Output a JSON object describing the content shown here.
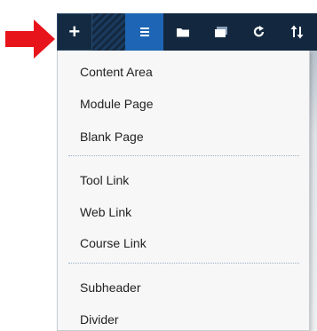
{
  "toolbar": {
    "add_label": "+",
    "buttons": [
      {
        "icon": "list-icon"
      },
      {
        "icon": "folder-icon"
      },
      {
        "icon": "window-icon"
      },
      {
        "icon": "refresh-icon"
      },
      {
        "icon": "sort-icon"
      }
    ]
  },
  "menu": {
    "groups": [
      [
        "Content Area",
        "Module Page",
        "Blank Page"
      ],
      [
        "Tool Link",
        "Web Link",
        "Course Link"
      ],
      [
        "Subheader",
        "Divider"
      ]
    ]
  },
  "colors": {
    "toolbar_bg": "#13283f",
    "active_button": "#1e66b5",
    "arrow": "#e8141b",
    "menu_bg": "#f7f7f7"
  }
}
